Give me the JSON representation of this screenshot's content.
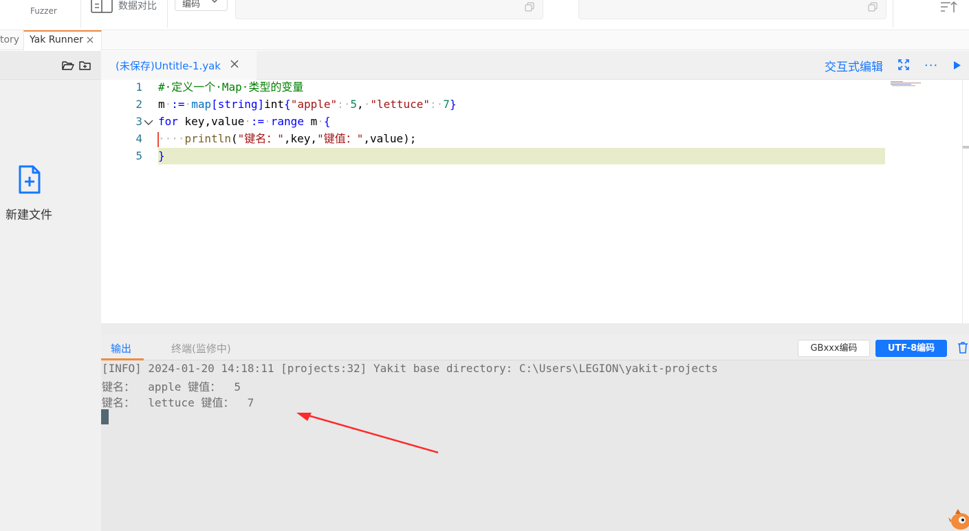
{
  "toolbar": {
    "fuzzer_label": "Fuzzer",
    "compare_label": "数据对比",
    "encode_select": "编码"
  },
  "tabs": {
    "history_partial": "tory",
    "active_tab": "Yak Runner"
  },
  "sidebar": {
    "new_file_label": "新建文件"
  },
  "editor": {
    "file_tab": "(未保存)Untitle-1.yak",
    "interactive_edit": "交互式编辑",
    "more": "···",
    "line_numbers": [
      "1",
      "2",
      "3",
      "4",
      "5"
    ]
  },
  "output": {
    "tab_output": "输出",
    "tab_terminal": "终端(监修中)",
    "btn_gbk": "GBxxx编码",
    "btn_utf8": "UTF-8编码",
    "lines": [
      "[INFO] 2024-01-20 14:18:11 [projects:32] Yakit base directory: C:\\Users\\LEGION\\yakit-projects",
      "键名：  apple 键值：  5",
      "键名：  lettuce 键值：  7"
    ]
  },
  "colors": {
    "accent": "#1677ff",
    "tab_indicator": "#f28b3b",
    "arrow": "#ff2a2a"
  }
}
